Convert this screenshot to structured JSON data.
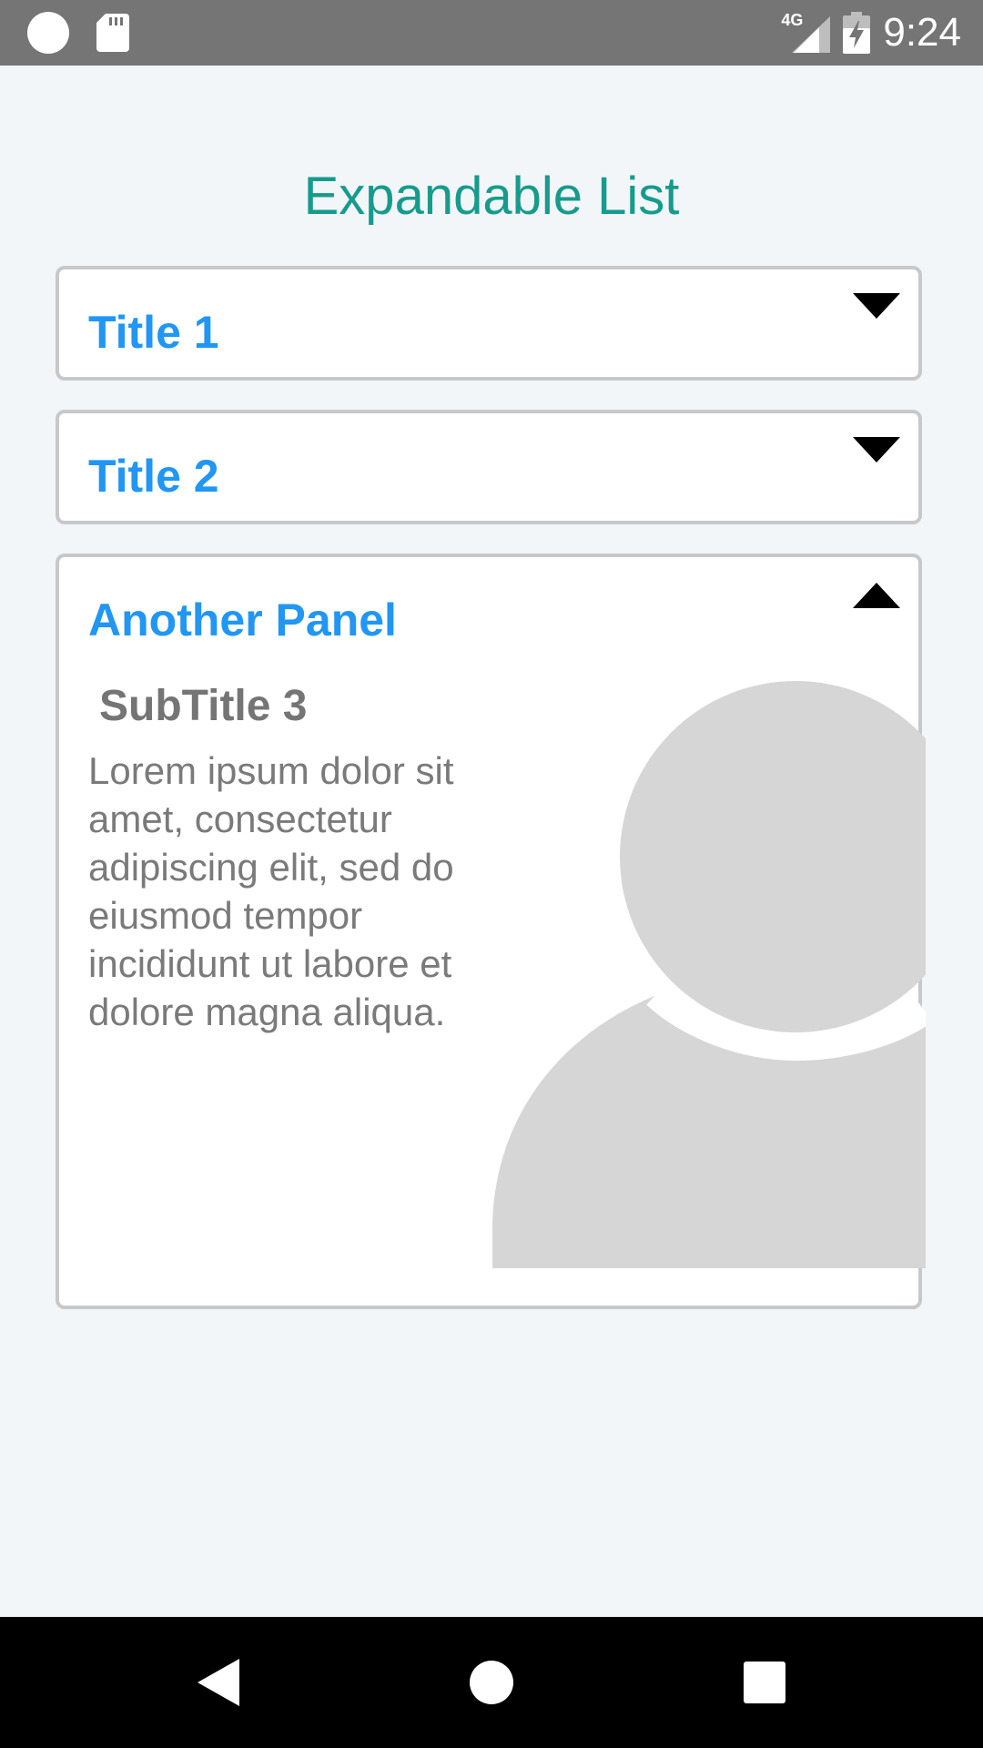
{
  "status_bar": {
    "time": "9:24",
    "network": "4G",
    "icons": [
      "notification-dot-icon",
      "sd-card-icon",
      "signal-4g-icon",
      "battery-charging-icon"
    ]
  },
  "page": {
    "title": "Expandable List"
  },
  "panels": [
    {
      "title": "Title 1",
      "expanded": false,
      "chevron": "chevron-down-icon"
    },
    {
      "title": "Title 2",
      "expanded": false,
      "chevron": "chevron-down-icon"
    },
    {
      "title": "Another Panel",
      "expanded": true,
      "chevron": "chevron-up-icon",
      "subtitle": "SubTitle 3",
      "body": "Lorem ipsum dolor sit amet, consectetur adipiscing elit, sed do eiusmod tempor incididunt ut labore et dolore magna aliqua.",
      "image": "avatar-placeholder-icon"
    }
  ],
  "nav_bar": {
    "buttons": [
      "back-icon",
      "home-icon",
      "recents-icon"
    ]
  },
  "colors": {
    "status_bar": "#757575",
    "background": "#f3f6f9",
    "page_title": "#169b8d",
    "panel_title": "#2196f3",
    "panel_border": "#c8c8c8",
    "subtitle": "#757575",
    "body_text": "#7a7a7a",
    "avatar": "#d6d6d6",
    "nav_bar": "#000000"
  }
}
